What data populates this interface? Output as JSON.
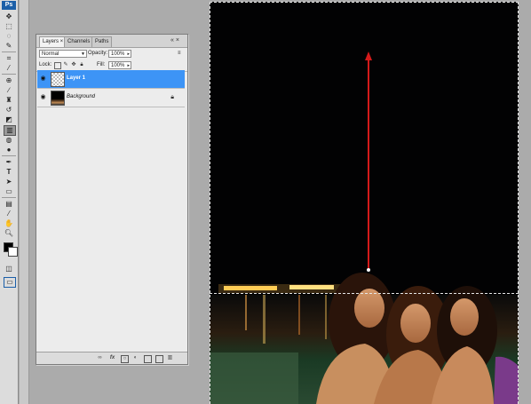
{
  "app": {
    "logo": "Ps"
  },
  "toolbox": {
    "tools": [
      "move-tool",
      "marquee-tool",
      "lasso-tool",
      "magic-wand-tool",
      "crop-tool",
      "eyedropper-tool",
      "healing-brush-tool",
      "brush-tool",
      "clone-stamp-tool",
      "history-brush-tool",
      "eraser-tool",
      "gradient-tool",
      "blur-tool",
      "dodge-tool",
      "pen-tool",
      "type-tool",
      "path-selection-tool",
      "shape-tool",
      "notes-tool",
      "eyedropper-tool-2",
      "hand-tool",
      "zoom-tool"
    ],
    "foreground_color": "#000000",
    "background_color": "#ffffff"
  },
  "layers_panel": {
    "tabs": [
      {
        "label": "Layers ×",
        "active": true
      },
      {
        "label": "Channels",
        "active": false
      },
      {
        "label": "Paths",
        "active": false
      }
    ],
    "panel_controls": "«  ×",
    "menu_icon": "≡",
    "blend_mode": "Normal",
    "opacity_label": "Opacity:",
    "opacity_value": "100%",
    "lock_label": "Lock:",
    "fill_label": "Fill:",
    "fill_value": "100%",
    "layers": [
      {
        "name": "Layer 1",
        "selected": true,
        "visible": true
      },
      {
        "name": "Background",
        "selected": false,
        "visible": true,
        "locked": true
      }
    ],
    "footer_icons": [
      "link-layers-icon",
      "fx-icon",
      "layer-mask-icon",
      "adjustment-layer-icon",
      "group-icon",
      "new-layer-icon",
      "delete-layer-icon"
    ]
  },
  "canvas": {
    "gradient_arrow_color": "#d41a1a",
    "selection_color": "#e6e6e6"
  }
}
